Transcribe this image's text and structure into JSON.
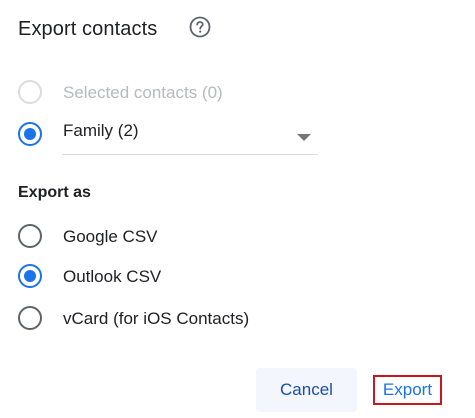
{
  "dialog": {
    "title": "Export contacts",
    "help_icon": "help-circle-icon"
  },
  "contacts_source": {
    "options": [
      {
        "label": "Selected contacts (0)",
        "selected": false,
        "disabled": true
      },
      {
        "label": "",
        "selected": true,
        "disabled": false
      }
    ],
    "group_dropdown": {
      "value": "Family (2)",
      "icon": "chevron-down-icon"
    }
  },
  "export_as": {
    "heading": "Export as",
    "options": [
      {
        "label": "Google CSV",
        "selected": false
      },
      {
        "label": "Outlook CSV",
        "selected": true
      },
      {
        "label": "vCard (for iOS Contacts)",
        "selected": false
      }
    ]
  },
  "actions": {
    "cancel_label": "Cancel",
    "export_label": "Export"
  },
  "colors": {
    "accent": "#1a73e8",
    "disabled": "#dadce0",
    "text": "#202124",
    "outline": "#c8171e"
  }
}
